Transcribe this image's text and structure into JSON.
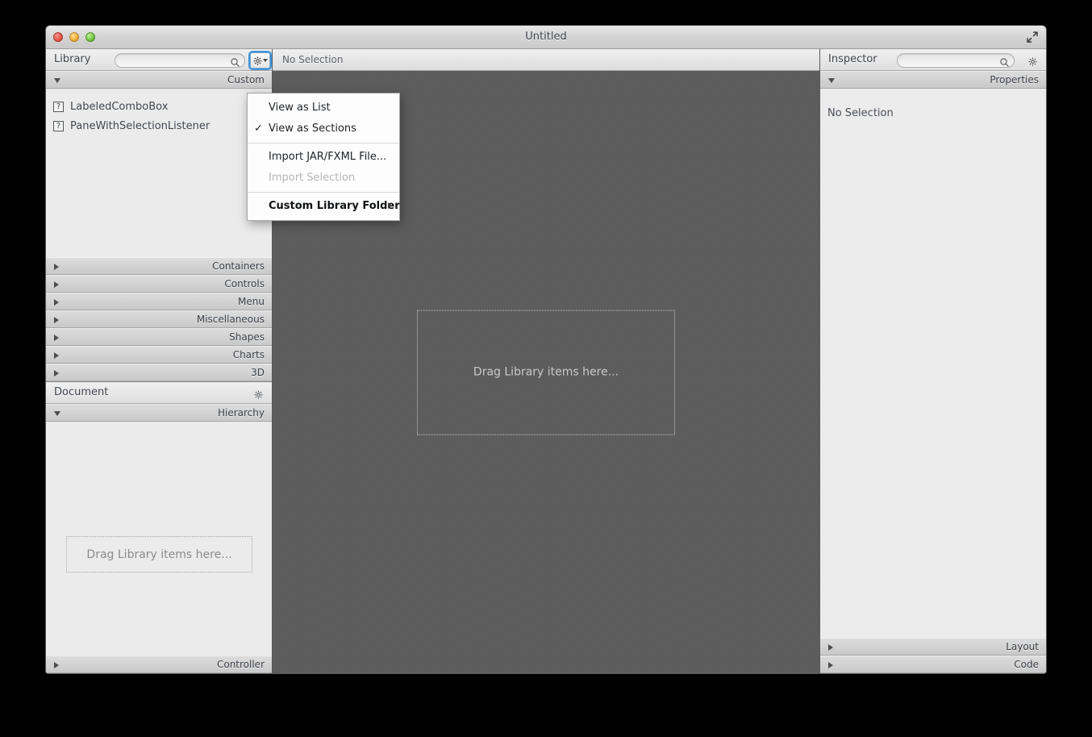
{
  "window": {
    "title": "Untitled",
    "traffic_lights": [
      "close-button",
      "minimize-button",
      "zoom-button"
    ],
    "fullscreen_icon": "fullscreen-arrows-icon"
  },
  "library": {
    "panel_title": "Library",
    "search_placeholder": "",
    "search_value": "",
    "search_icon": "search-icon",
    "gear_icon": "gear-icon",
    "custom_section": {
      "label": "Custom",
      "expanded": true,
      "items": [
        {
          "icon": "question-mark-icon",
          "label": "LabeledComboBox"
        },
        {
          "icon": "question-mark-icon",
          "label": "PaneWithSelectionListener"
        }
      ]
    },
    "sections": [
      {
        "label": "Containers",
        "expanded": false
      },
      {
        "label": "Controls",
        "expanded": false
      },
      {
        "label": "Menu",
        "expanded": false
      },
      {
        "label": "Miscellaneous",
        "expanded": false
      },
      {
        "label": "Shapes",
        "expanded": false
      },
      {
        "label": "Charts",
        "expanded": false
      },
      {
        "label": "3D",
        "expanded": false
      }
    ]
  },
  "document": {
    "panel_title": "Document",
    "gear_icon": "gear-icon",
    "hierarchy": {
      "label": "Hierarchy",
      "expanded": true,
      "dropzone_text": "Drag Library items here..."
    },
    "controller": {
      "label": "Controller",
      "expanded": false
    }
  },
  "content": {
    "selection_label": "No Selection",
    "dropzone_text": "Drag Library items here..."
  },
  "inspector": {
    "panel_title": "Inspector",
    "search_placeholder": "",
    "search_value": "",
    "search_icon": "search-icon",
    "gear_icon": "gear-icon",
    "properties": {
      "label": "Properties",
      "expanded": true,
      "empty_text": "No Selection"
    },
    "sections": [
      {
        "label": "Layout",
        "expanded": false
      },
      {
        "label": "Code",
        "expanded": false
      }
    ]
  },
  "menu": {
    "items": [
      {
        "label": "View as List",
        "checked": false,
        "disabled": false,
        "submenu": false,
        "bold": false
      },
      {
        "label": "View as Sections",
        "checked": true,
        "disabled": false,
        "submenu": false,
        "bold": false
      },
      {
        "separator": true
      },
      {
        "label": "Import JAR/FXML File...",
        "checked": false,
        "disabled": false,
        "submenu": false,
        "bold": false
      },
      {
        "label": "Import Selection",
        "checked": false,
        "disabled": true,
        "submenu": false,
        "bold": false
      },
      {
        "separator": true
      },
      {
        "label": "Custom Library Folder",
        "checked": false,
        "disabled": false,
        "submenu": true,
        "bold": true
      }
    ],
    "check_glyph": "✓",
    "submenu_arrow": "▶"
  },
  "colors": {
    "focus_ring": "#3f93d8",
    "canvas_bg": "#5b5b5b",
    "panel_bg": "#ebebeb"
  }
}
